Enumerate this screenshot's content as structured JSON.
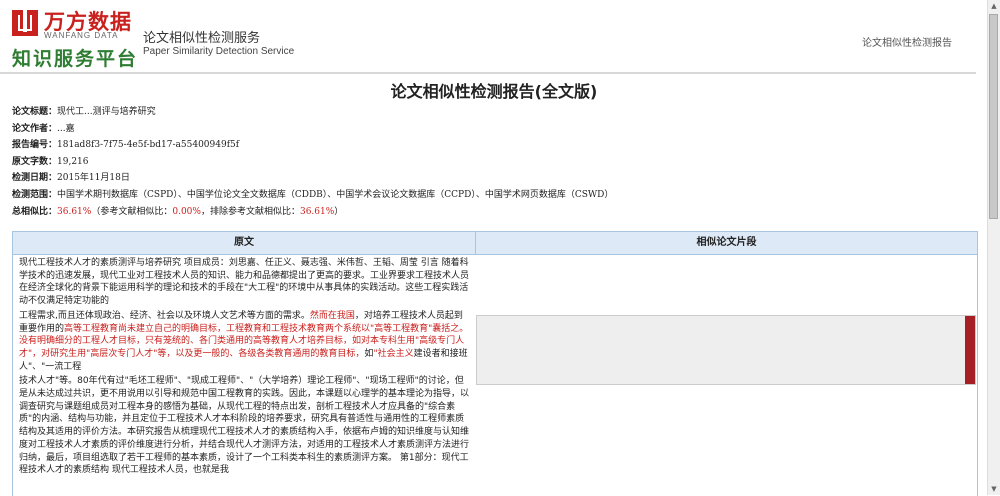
{
  "brand": {
    "name_cn": "万方数据",
    "name_en": "WANFANG DATA",
    "platform": "知识服务平台",
    "service_cn": "论文相似性检测服务",
    "service_en": "Paper Similarity Detection Service",
    "top_link": "论文相似性检测报告"
  },
  "report": {
    "title": "论文相似性检测报告(全文版)",
    "meta": [
      {
        "label": "论文标题：",
        "value": "现代工...测评与培养研究"
      },
      {
        "label": "论文作者：",
        "value": "...嘉"
      },
      {
        "label": "报告编号：",
        "value": "181ad8f3-7f75-4e5f-bd17-a55400949f5f"
      },
      {
        "label": "原文字数：",
        "value": "19,216"
      },
      {
        "label": "检测日期：",
        "value": "2015年11月18日"
      },
      {
        "label": "检测范围：",
        "value": "中国学术期刊数据库（CSPD）、中国学位论文全文数据库（CDDB）、中国学术会议论文数据库（CCPD）、中国学术网页数据库（CSWD）"
      }
    ],
    "similarity": {
      "label": "总相似比：",
      "total": "36.61%",
      "ref_text": "（参考文献相似比：",
      "ref_value": "0.00%",
      "exclude_text": "，排除参考文献相似比：",
      "exclude_value": "36.61%",
      "end": "）"
    }
  },
  "compare": {
    "left_header": "原文",
    "right_header": "相似论文片段",
    "para1": "现代工程技术人才的素质测评与培养研究 项目成员：刘思嘉、任正义、聂志强、米伟哲、王韬、周莹 引言 随着科学技术的迅速发展，现代工业对工程技术人员的知识、能力和品德都提出了更高的要求。工业界要求工程技术人员在经济全球化的背景下能运用科学的理论和技术的手段在\"大工程\"的环境中从事具体的实践活动。这些工程实践活动不仅满足特定功能的",
    "para2_a": "工程需求,而且还体现政治、经济、社会以及环境人文艺术等方面的需求。",
    "para2_b": "然而在我国",
    "para2_c": "，对培养工程技术人员起到重要作用的",
    "para2_d": "高等工程教育尚未建立自己的明确目标，工程教育和工程技术教育两个系统以\"高等工程教育\"囊括之。没有明确细分的工程人才目标，只有笼统的、各门类通用的高等教育人才培养目标，如对本专科生用\"高级专门人才\"，对研究生用\"高层次专门人才\"等，以及更一般的、各级各类教育通用的教育目标，",
    "para2_e": "如",
    "para2_f": "\"社会主义",
    "para2_g": "建设者和接班人\"、\"一流工程",
    "para3": "技术人才\"等。80年代有过\"毛坯工程师\"、\"现成工程师\"、\"（大学培养）理论工程师\"、\"现场工程师\"的讨论，但是从未达成过共识，更不用说用以引导和规范中国工程教育的实践。因此，本课题以心理学的基本理论为指导，以调查研究与课题组成员对工程本身的感悟为基础，从现代工程的特点出发，剖析工程技术人才应具备的\"综合素质\"的内涵、结构与功能，并且定位于工程技术人才本科阶段的培养要求，研究具有普适性与通用性的工程师素质结构及其适用的评价方法。本研究报告从梳理现代工程技术人才的素质结构入手，依据布卢姆的知识维度与认知维度对工程技术人才素质的评价维度进行分析，并结合现代人才测评方法，对适用的工程技术人才素质测评方法进行归纳，最后，项目组选取了若干工程师的基本素质，设计了一个工科类本科生的素质测评方案。 第1部分：现代工程技术人才的素质结构 现代工程技术人员，也就是我"
  }
}
